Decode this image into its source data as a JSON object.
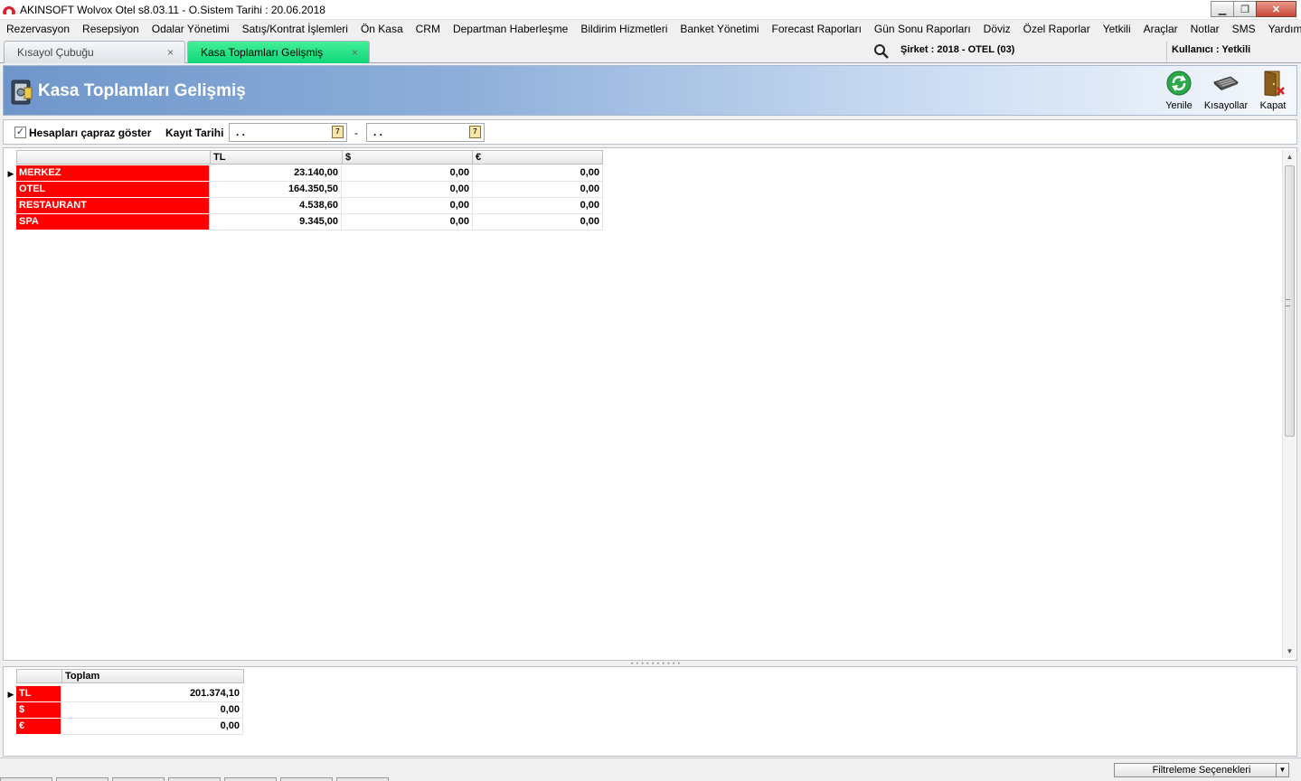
{
  "window": {
    "title": "AKINSOFT Wolvox Otel s8.03.11 - O.Sistem Tarihi : 20.06.2018",
    "minimize": "▁",
    "maximize": "❐",
    "close": "✕"
  },
  "menu": [
    "Rezervasyon",
    "Resepsiyon",
    "Odalar Yönetimi",
    "Satış/Kontrat İşlemleri",
    "Ön Kasa",
    "CRM",
    "Departman Haberleşme",
    "Bildirim Hizmetleri",
    "Banket Yönetimi",
    "Forecast Raporları",
    "Gün Sonu Raporları",
    "Döviz",
    "Özel Raporlar",
    "Yetkili",
    "Araçlar",
    "Notlar",
    "SMS",
    "Yardım"
  ],
  "tabs": [
    {
      "label": "Kısayol Çubuğu",
      "close": "×"
    },
    {
      "label": "Kasa Toplamları Gelişmiş",
      "close": "×"
    }
  ],
  "session": {
    "company": "Şirket : 2018 - OTEL (03)",
    "user": "Kullanıcı : Yetkili"
  },
  "header": {
    "title": "Kasa Toplamları Gelişmiş",
    "buttons": [
      {
        "label": "Yenile",
        "icon": "refresh-icon"
      },
      {
        "label": "Kısayollar",
        "icon": "keyboard-icon"
      },
      {
        "label": "Kapat",
        "icon": "exit-door-icon"
      }
    ]
  },
  "filters": {
    "cross_accounts_label": "Hesapları çapraz göster",
    "cross_accounts_checked": true,
    "check_mark": "✓",
    "date_label": "Kayıt Tarihi",
    "date_from": ". .",
    "date_to": ". .",
    "date_separator": "-",
    "calendar_glyph": "7"
  },
  "main_grid": {
    "columns": [
      "",
      "TL",
      "$",
      "€"
    ],
    "rows": [
      {
        "name": "MERKEZ",
        "tl": "23.140,00",
        "usd": "0,00",
        "eur": "0,00"
      },
      {
        "name": "OTEL",
        "tl": "164.350,50",
        "usd": "0,00",
        "eur": "0,00"
      },
      {
        "name": "RESTAURANT",
        "tl": "4.538,60",
        "usd": "0,00",
        "eur": "0,00"
      },
      {
        "name": "SPA",
        "tl": "9.345,00",
        "usd": "0,00",
        "eur": "0,00"
      }
    ],
    "current_row_marker": "▶",
    "scroll_up": "▲",
    "scroll_down": "▼"
  },
  "total_grid": {
    "columns": [
      "",
      "Toplam"
    ],
    "rows": [
      {
        "currency": "TL",
        "total": "201.374,10"
      },
      {
        "currency": "$",
        "total": "0,00"
      },
      {
        "currency": "€",
        "total": "0,00"
      }
    ]
  },
  "status": {
    "filter_options": "Filtreleme Seçenekleri",
    "dropdown": "▼"
  },
  "colors": {
    "highlight_red": "#ff0000",
    "active_tab": "#0ed677",
    "header_blue": "#6f96cb"
  }
}
